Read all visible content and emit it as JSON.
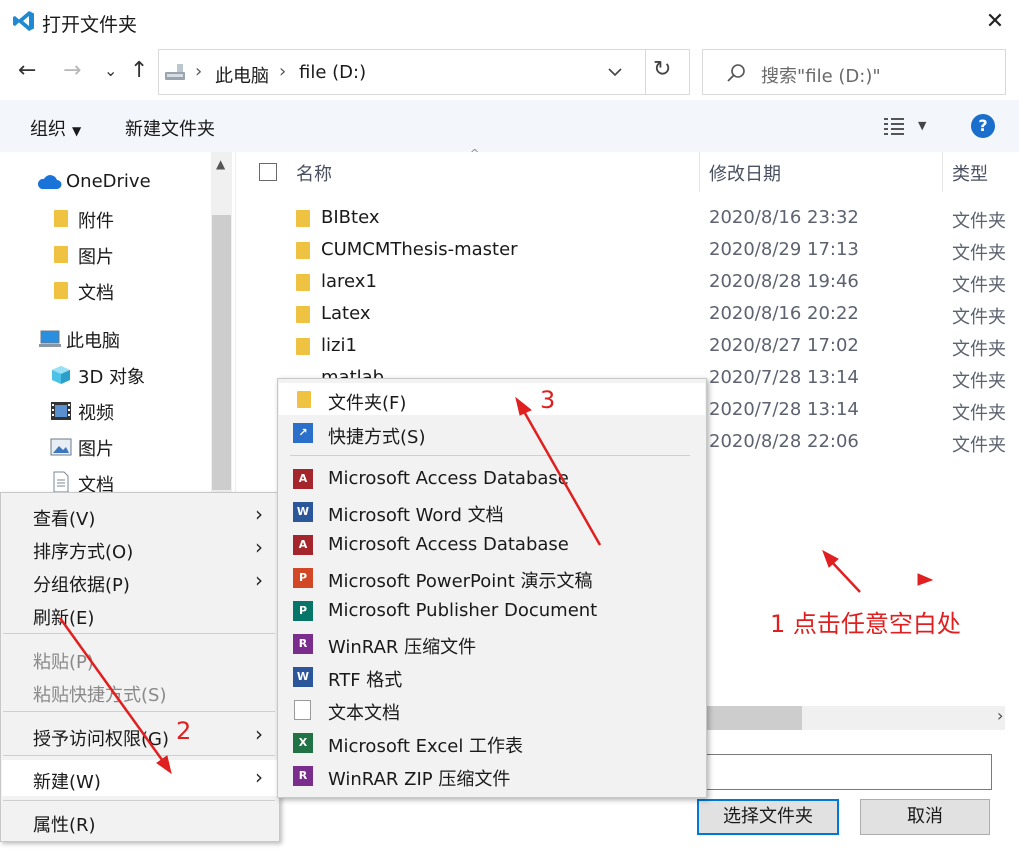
{
  "window": {
    "title": "打开文件夹",
    "close_glyph": "✕"
  },
  "nav": {
    "back": "←",
    "forward": "→",
    "recent": "⌄",
    "up": "↑",
    "breadcrumb": [
      "此电脑",
      "file (D:)"
    ],
    "separator": "›",
    "refresh": "↻",
    "search_placeholder": "搜索\"file (D:)\""
  },
  "toolbar": {
    "organize": "组织",
    "new_folder": "新建文件夹",
    "help": "?"
  },
  "sidebar": {
    "items": [
      {
        "label": "OneDrive",
        "icon": "cloud-icon"
      },
      {
        "label": "附件",
        "icon": "folder-icon"
      },
      {
        "label": "图片",
        "icon": "folder-icon"
      },
      {
        "label": "文档",
        "icon": "folder-icon"
      },
      {
        "label": "此电脑",
        "icon": "computer-icon"
      },
      {
        "label": "3D 对象",
        "icon": "cube-icon"
      },
      {
        "label": "视频",
        "icon": "film-icon"
      },
      {
        "label": "图片",
        "icon": "picture-icon"
      },
      {
        "label": "文档",
        "icon": "document-icon"
      }
    ]
  },
  "table": {
    "columns": [
      "名称",
      "修改日期",
      "类型"
    ],
    "rows": [
      {
        "name": "BIBtex",
        "date": "2020/8/16 23:32",
        "type": "文件夹"
      },
      {
        "name": "CUMCMThesis-master",
        "date": "2020/8/29 17:13",
        "type": "文件夹"
      },
      {
        "name": "larex1",
        "date": "2020/8/28 19:46",
        "type": "文件夹"
      },
      {
        "name": "Latex",
        "date": "2020/8/16 20:22",
        "type": "文件夹"
      },
      {
        "name": "lizi1",
        "date": "2020/8/27 17:02",
        "type": "文件夹"
      },
      {
        "name": "matlab",
        "date": "2020/7/28 13:14",
        "type": "文件夹"
      },
      {
        "name": "",
        "date": "2020/7/28 13:14",
        "type": "文件夹"
      },
      {
        "name": "",
        "date": "2020/8/28 22:06",
        "type": "文件夹"
      }
    ]
  },
  "footer": {
    "select_button": "选择文件夹",
    "cancel_button": "取消"
  },
  "context_menu": {
    "items": [
      {
        "label": "查看(V)",
        "submenu": true,
        "disabled": false
      },
      {
        "label": "排序方式(O)",
        "submenu": true,
        "disabled": false
      },
      {
        "label": "分组依据(P)",
        "submenu": true,
        "disabled": false
      },
      {
        "label": "刷新(E)",
        "submenu": false,
        "disabled": false
      },
      {
        "label": "粘贴(P)",
        "submenu": false,
        "disabled": true
      },
      {
        "label": "粘贴快捷方式(S)",
        "submenu": false,
        "disabled": true
      },
      {
        "label": "授予访问权限(G)",
        "submenu": true,
        "disabled": false
      },
      {
        "label": "新建(W)",
        "submenu": true,
        "disabled": false
      },
      {
        "label": "属性(R)",
        "submenu": false,
        "disabled": false
      }
    ]
  },
  "new_submenu": {
    "items": [
      {
        "label": "文件夹(F)",
        "icon": "folder-icon",
        "color": "#f0c242"
      },
      {
        "label": "快捷方式(S)",
        "icon": "shortcut-icon",
        "color": "#2a6fc9"
      },
      {
        "label": "Microsoft Access Database",
        "icon": "access-icon",
        "color": "#a4262c"
      },
      {
        "label": "Microsoft Word 文档",
        "icon": "word-icon",
        "color": "#2b579a"
      },
      {
        "label": "Microsoft Access Database",
        "icon": "access-icon",
        "color": "#a4262c"
      },
      {
        "label": "Microsoft PowerPoint 演示文稿",
        "icon": "powerpoint-icon",
        "color": "#d24726"
      },
      {
        "label": "Microsoft Publisher Document",
        "icon": "publisher-icon",
        "color": "#077568"
      },
      {
        "label": "WinRAR 压缩文件",
        "icon": "winrar-icon",
        "color": "#7a2d8c"
      },
      {
        "label": "RTF 格式",
        "icon": "rtf-icon",
        "color": "#2b579a"
      },
      {
        "label": "文本文档",
        "icon": "text-file-icon",
        "color": "#9a9a9a"
      },
      {
        "label": "Microsoft Excel 工作表",
        "icon": "excel-icon",
        "color": "#217346"
      },
      {
        "label": "WinRAR ZIP 压缩文件",
        "icon": "winrar-icon",
        "color": "#7a2d8c"
      }
    ]
  },
  "annotations": {
    "step1": "1 点击任意空白处",
    "step2": "2",
    "step3": "3",
    "color": "#e02020"
  }
}
